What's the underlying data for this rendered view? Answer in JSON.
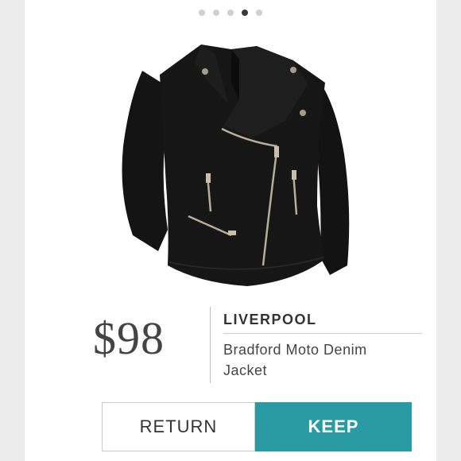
{
  "carousel": {
    "count": 5,
    "active_index": 3
  },
  "product": {
    "price": "$98",
    "brand": "LIVERPOOL",
    "name": "Bradford Moto Denim Jacket",
    "image_alt": "black moto jacket"
  },
  "actions": {
    "return_label": "RETURN",
    "keep_label": "KEEP"
  },
  "colors": {
    "keep_button": "#2a9ba3",
    "jacket": "#141414",
    "zipper": "#b8ad98"
  }
}
